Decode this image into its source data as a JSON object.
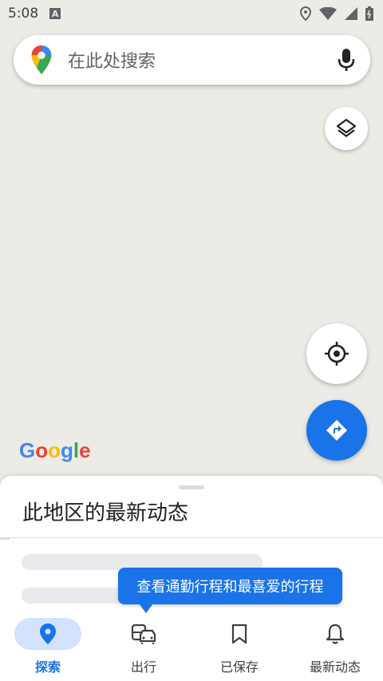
{
  "status_bar": {
    "time": "5:08",
    "badge_letter": "A"
  },
  "search": {
    "placeholder": "在此处搜索"
  },
  "map": {
    "logo_text": "Google"
  },
  "sheet": {
    "title": "此地区的最新动态"
  },
  "tooltip": {
    "text": "查看通勤行程和最喜爱的行程"
  },
  "bottom_nav": {
    "items": [
      {
        "label": "探索",
        "icon": "place-pin-icon",
        "active": true
      },
      {
        "label": "出行",
        "icon": "commute-icon",
        "active": false
      },
      {
        "label": "已保存",
        "icon": "bookmark-icon",
        "active": false
      },
      {
        "label": "最新动态",
        "icon": "bell-icon",
        "active": false
      }
    ]
  },
  "colors": {
    "accent": "#1a73e8",
    "map_background": "#ecebe5",
    "active_pill": "#d3e3fd"
  }
}
